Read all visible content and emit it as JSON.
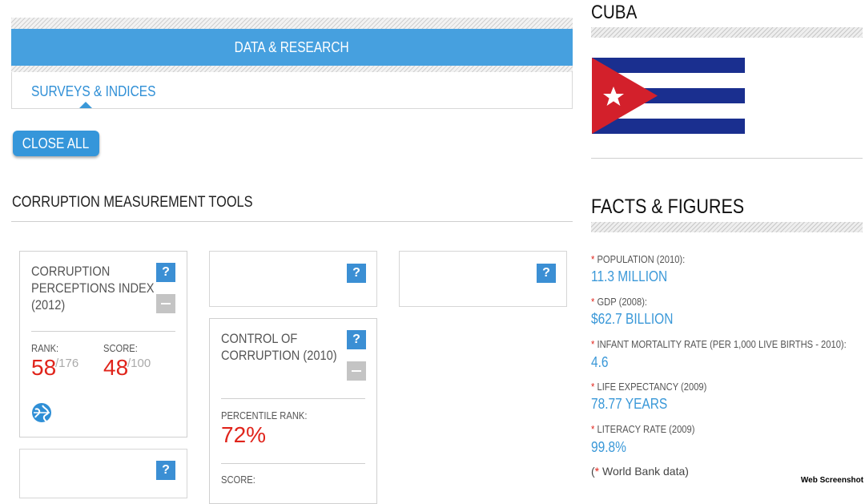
{
  "data_research": {
    "header": "DATA & RESEARCH",
    "sub_link": "SURVEYS & INDICES",
    "close_all": "CLOSE ALL"
  },
  "tools": {
    "title": "CORRUPTION MEASUREMENT TOOLS",
    "cpi": {
      "title_lines": [
        "CORRUPTION",
        "PERCEPTIONS INDEX",
        "(2012)"
      ],
      "rank_label": "RANK:",
      "rank_value": "58",
      "rank_total": "/176",
      "score_label": "SCORE:",
      "score_value": "48",
      "score_total": "/100",
      "icon": "globe-icon"
    },
    "control": {
      "title_lines": [
        "CONTROL OF",
        "CORRUPTION (2010)"
      ],
      "percentile_label": "PERCENTILE RANK:",
      "percentile_value": "72%",
      "score_label": "SCORE:"
    },
    "help_glyph": "?"
  },
  "country": {
    "name": "CUBA",
    "flag_colors": {
      "blue": "#1a2f8f",
      "red": "#d3202b",
      "white": "#ffffff"
    }
  },
  "facts": {
    "title": "FACTS & FIGURES",
    "star": "*",
    "items": [
      {
        "label": "POPULATION (2010):",
        "value": "11.3 MILLION"
      },
      {
        "label": "GDP (2008):",
        "value": "$62.7 BILLION"
      },
      {
        "label": "INFANT MORTALITY RATE (PER 1,000 LIVE BIRTHS - 2010):",
        "value": "4.6"
      },
      {
        "label": "LIFE EXPECTANCY (2009)",
        "value": "78.77 YEARS"
      },
      {
        "label": "LITERACY RATE (2009)",
        "value": "99.8%"
      }
    ],
    "note_open": "(",
    "note_star": "*",
    "note_text": " World Bank data)"
  },
  "watermark": "Web Screenshot",
  "colors": {
    "accent_blue": "#46a0df",
    "link_blue": "#3a98d8",
    "red": "#e0241b"
  }
}
